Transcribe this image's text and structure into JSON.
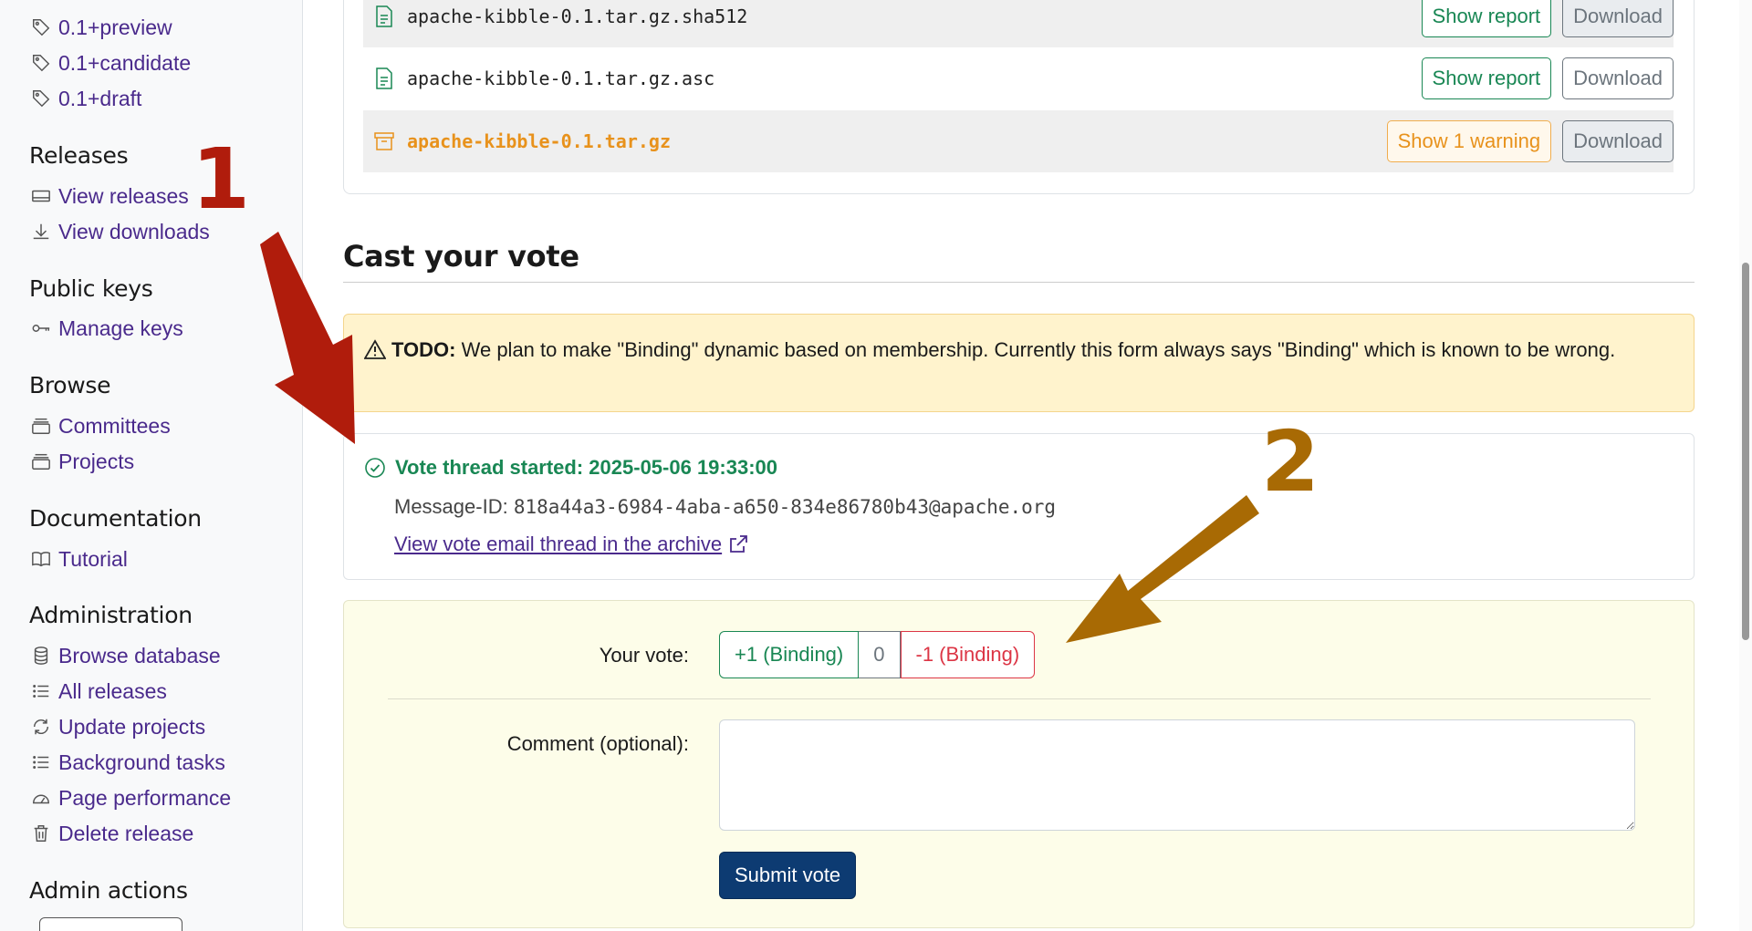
{
  "sidebar": {
    "tags": [
      {
        "label": "0.1+preview",
        "icon": "tag-icon"
      },
      {
        "label": "0.1+candidate",
        "icon": "tag-icon"
      },
      {
        "label": "0.1+draft",
        "icon": "tag-icon"
      }
    ],
    "releases": {
      "title": "Releases",
      "items": [
        {
          "label": "View releases",
          "icon": "releases-icon"
        },
        {
          "label": "View downloads",
          "icon": "download-icon"
        }
      ]
    },
    "public_keys": {
      "title": "Public keys",
      "items": [
        {
          "label": "Manage keys",
          "icon": "key-icon"
        }
      ]
    },
    "browse": {
      "title": "Browse",
      "items": [
        {
          "label": "Committees",
          "icon": "collection-icon"
        },
        {
          "label": "Projects",
          "icon": "collection-icon"
        }
      ]
    },
    "documentation": {
      "title": "Documentation",
      "items": [
        {
          "label": "Tutorial",
          "icon": "book-icon"
        }
      ]
    },
    "administration": {
      "title": "Administration",
      "items": [
        {
          "label": "Browse database",
          "icon": "database-icon"
        },
        {
          "label": "All releases",
          "icon": "list-icon"
        },
        {
          "label": "Update projects",
          "icon": "refresh-icon"
        },
        {
          "label": "Background tasks",
          "icon": "list-icon"
        },
        {
          "label": "Page performance",
          "icon": "speedometer-icon"
        },
        {
          "label": "Delete release",
          "icon": "trash-icon"
        }
      ]
    },
    "admin_actions": {
      "title": "Admin actions"
    }
  },
  "files": [
    {
      "name": "apache-kibble-0.1.tar.gz.sha512",
      "report_label": "Show report",
      "download_label": "Download"
    },
    {
      "name": "apache-kibble-0.1.tar.gz.asc",
      "report_label": "Show report",
      "download_label": "Download"
    },
    {
      "name": "apache-kibble-0.1.tar.gz",
      "report_label": "Show 1 warning",
      "download_label": "Download"
    }
  ],
  "cast_vote": {
    "heading": "Cast your vote",
    "todo_label": "TODO:",
    "todo_text": "We plan to make \"Binding\" dynamic based on membership. Currently this form always says \"Binding\" which is known to be wrong.",
    "thread_started": "Vote thread started: 2025-05-06 19:33:00",
    "message_id_label": "Message-ID:",
    "message_id": "818a44a3-6984-4aba-a650-834e86780b43@apache.org",
    "archive_link": "View vote email thread in the archive",
    "your_vote_label": "Your vote:",
    "vote_options": [
      "+1 (Binding)",
      "0",
      "-1 (Binding)"
    ],
    "comment_label": "Comment (optional):",
    "comment_value": "",
    "submit_label": "Submit vote"
  },
  "annotations": {
    "first": "1",
    "second": "2"
  },
  "colors": {
    "link": "#4a2a8c",
    "success": "#198754",
    "danger": "#dc3545",
    "warning": "#e8921c",
    "primary_dark": "#0d3b72",
    "arrow_red": "#b01c0c",
    "arrow_brown": "#a86a04"
  }
}
